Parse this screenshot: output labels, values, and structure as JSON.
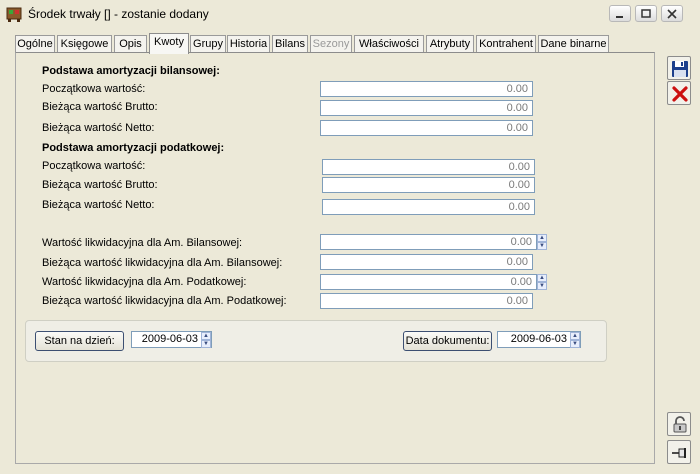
{
  "window": {
    "title": "Środek trwały [] - zostanie dodany"
  },
  "tabs": [
    {
      "label": "Ogólne"
    },
    {
      "label": "Księgowe"
    },
    {
      "label": "Opis"
    },
    {
      "label": "Kwoty"
    },
    {
      "label": "Grupy"
    },
    {
      "label": "Historia"
    },
    {
      "label": "Bilans"
    },
    {
      "label": "Sezony"
    },
    {
      "label": "Właściwości"
    },
    {
      "label": "Atrybuty"
    },
    {
      "label": "Kontrahent"
    },
    {
      "label": "Dane binarne"
    }
  ],
  "active_tab": "Kwoty",
  "bilans": {
    "title": "Podstawa amortyzacji bilansowej:",
    "rows": [
      {
        "label": "Początkowa wartość:",
        "value": "0.00"
      },
      {
        "label": "Bieżąca wartość Brutto:",
        "value": "0.00"
      },
      {
        "label": "Bieżąca wartość Netto:",
        "value": "0.00"
      }
    ]
  },
  "podatkowa": {
    "title": "Podstawa amortyzacji podatkowej:",
    "rows": [
      {
        "label": "Początkowa wartość:",
        "value": "0.00"
      },
      {
        "label": "Bieżąca wartość Brutto:",
        "value": "0.00"
      },
      {
        "label": "Bieżąca wartość Netto:",
        "value": "0.00"
      }
    ]
  },
  "likwidacyjna": [
    {
      "label": "Wartość likwidacyjna dla Am. Bilansowej:",
      "value": "0.00"
    },
    {
      "label": "Bieżąca wartość likwidacyjna dla Am. Bilansowej:",
      "value": "0.00"
    },
    {
      "label": "Wartość likwidacyjna dla Am. Podatkowej:",
      "value": "0.00"
    },
    {
      "label": "Bieżąca wartość likwidacyjna dla Am. Podatkowej:",
      "value": "0.00"
    }
  ],
  "stan": {
    "button": "Stan na dzień:",
    "date": "2009-06-03"
  },
  "dokument": {
    "button": "Data dokumentu:",
    "date": "2009-06-03"
  },
  "colors": {
    "save": "#1c3f8c",
    "cancel": "#cc1111",
    "field_border": "#7f9db9"
  }
}
